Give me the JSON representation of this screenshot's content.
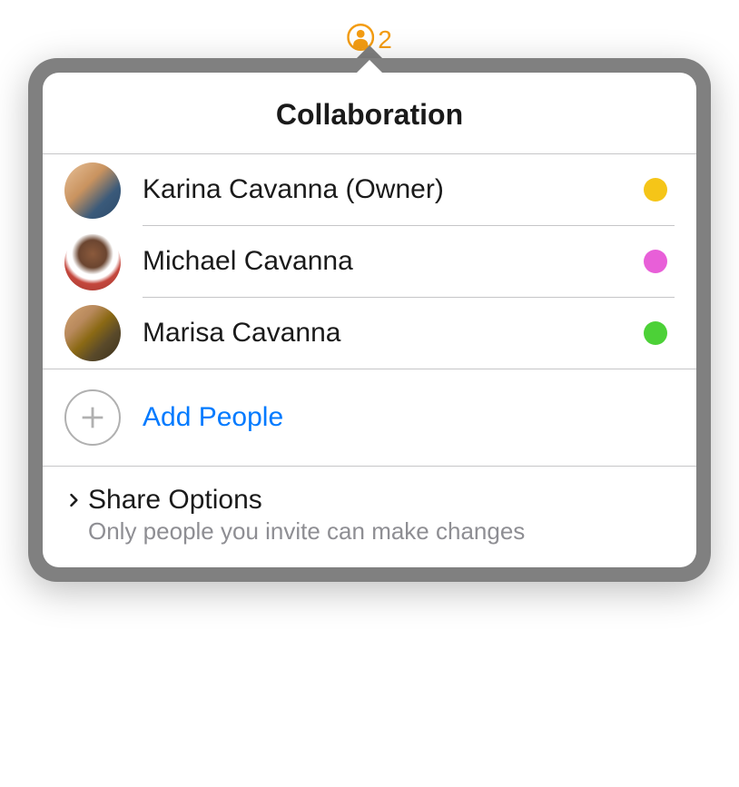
{
  "badge": {
    "count": "2"
  },
  "popover": {
    "title": "Collaboration",
    "participants": [
      {
        "name": "Karina Cavanna (Owner)",
        "statusColor": "#f5c518"
      },
      {
        "name": "Michael Cavanna",
        "statusColor": "#e85fd8"
      },
      {
        "name": "Marisa Cavanna",
        "statusColor": "#4cd137"
      }
    ],
    "addPeople": {
      "label": "Add People"
    },
    "shareOptions": {
      "title": "Share Options",
      "subtitle": "Only people you invite can make changes"
    }
  },
  "colors": {
    "accent": "#007aff",
    "badge": "#f39c12"
  }
}
